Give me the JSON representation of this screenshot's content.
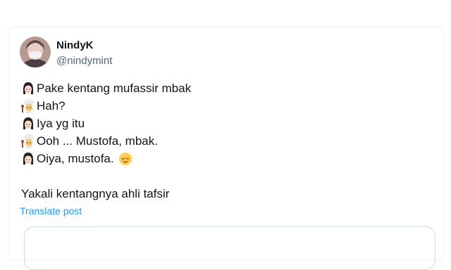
{
  "post": {
    "display_name": "NindyK",
    "handle": "@nindymint",
    "lines": [
      {
        "speaker": "woman",
        "text": "Pake kentang mufassir mbak"
      },
      {
        "speaker": "cook",
        "text": "Hah?"
      },
      {
        "speaker": "woman",
        "text": "Iya yg itu"
      },
      {
        "speaker": "cook",
        "text": "Ooh ... Mustofa, mbak."
      },
      {
        "speaker": "woman",
        "text": "Oiya, mustofa."
      }
    ],
    "trailing_emoji": "relieved-face-icon",
    "closing_text": "Yakali kentangnya ahli tafsir",
    "translate_label": "Translate post"
  },
  "colors": {
    "text": "#0f1419",
    "secondary": "#536471",
    "link": "#1d9bf0",
    "border": "#cfd9de"
  }
}
